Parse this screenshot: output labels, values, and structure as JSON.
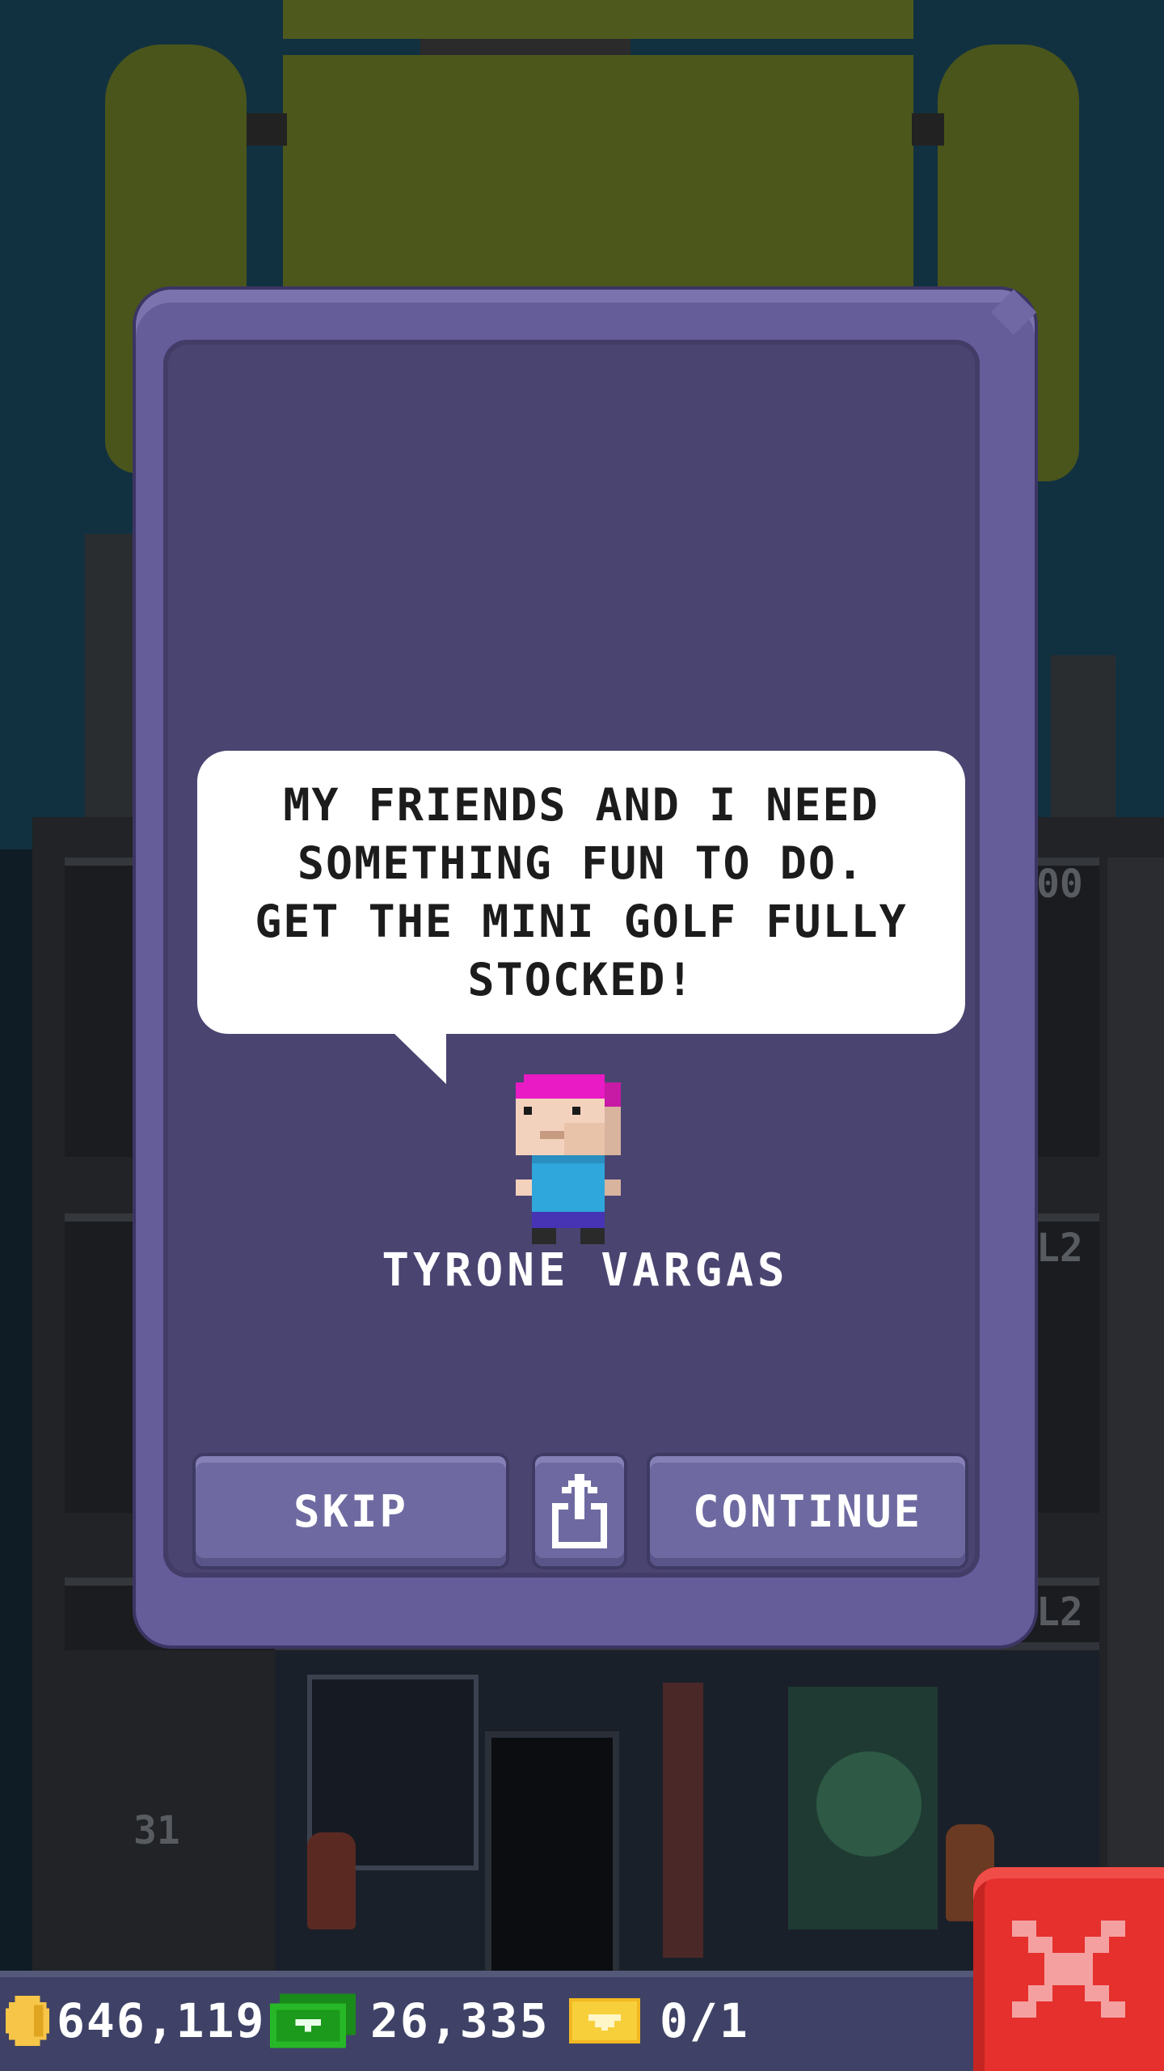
{
  "dialog": {
    "speech_text": "MY FRIENDS AND I NEED SOMETHING FUN TO DO. GET THE MINI GOLF FULLY STOCKED!",
    "character_name": "TYRONE VARGAS",
    "character_icon": "bitizen-avatar",
    "buttons": {
      "skip_label": "SKIP",
      "share_icon": "share-icon",
      "continue_label": "CONTINUE"
    }
  },
  "hud": {
    "coins": "646,119",
    "coin_icon": "coin-icon",
    "bux": "26,335",
    "bux_icon": "bux-icon",
    "tickets": "0/1",
    "ticket_icon": "golden-ticket-icon"
  },
  "background": {
    "level_numbers": [
      "00",
      "L2",
      "L2",
      "31"
    ]
  },
  "close_icon": "close-icon",
  "colors": {
    "dialog_frame": "#655c9a",
    "dialog_inner": "#4a4471",
    "button": "#6e6aa1",
    "close_button": "#e5302d",
    "hud_bar": "#3f4266",
    "hair": "#e81bc4",
    "shirt": "#2fa6dc"
  }
}
